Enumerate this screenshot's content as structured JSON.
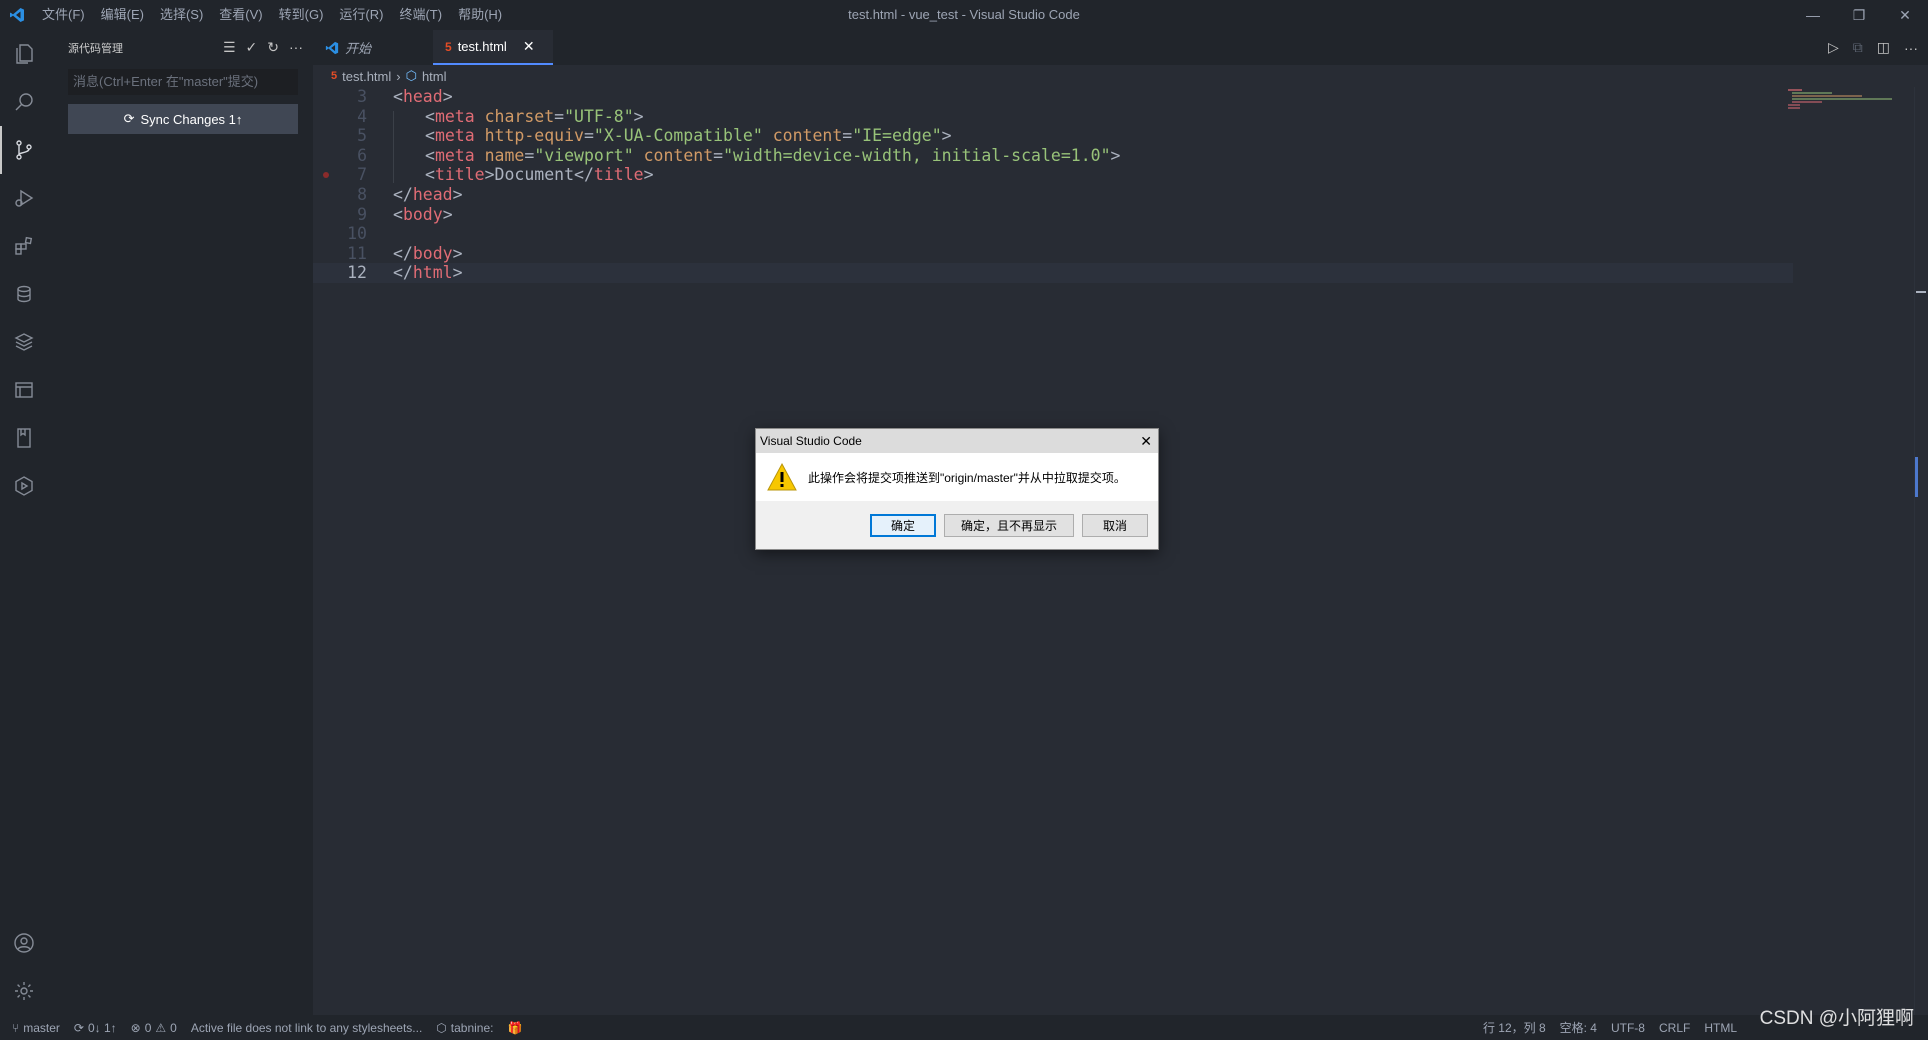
{
  "titlebar": {
    "menu": [
      "文件(F)",
      "编辑(E)",
      "选择(S)",
      "查看(V)",
      "转到(G)",
      "运行(R)",
      "终端(T)",
      "帮助(H)"
    ],
    "window_title": "test.html - vue_test - Visual Studio Code"
  },
  "sidebar": {
    "title": "源代码管理",
    "commit_placeholder": "消息(Ctrl+Enter 在\"master\"提交)",
    "sync_label": "Sync Changes 1↑"
  },
  "tabs": [
    {
      "label": "开始"
    },
    {
      "label": "test.html"
    }
  ],
  "breadcrumb": {
    "file": "test.html",
    "symbol": "html"
  },
  "editor": {
    "lines": [
      {
        "num": "3",
        "indent": 0,
        "tokens": [
          [
            "p",
            "<"
          ],
          [
            "t",
            "head"
          ],
          [
            "p",
            ">"
          ]
        ]
      },
      {
        "num": "4",
        "indent": 1,
        "tokens": [
          [
            "p",
            "<"
          ],
          [
            "t",
            "meta"
          ],
          [
            "p",
            " "
          ],
          [
            "a",
            "charset"
          ],
          [
            "p",
            "="
          ],
          [
            "s",
            "\"UTF-8\""
          ],
          [
            "p",
            ">"
          ]
        ]
      },
      {
        "num": "5",
        "indent": 1,
        "tokens": [
          [
            "p",
            "<"
          ],
          [
            "t",
            "meta"
          ],
          [
            "p",
            " "
          ],
          [
            "a",
            "http-equiv"
          ],
          [
            "p",
            "="
          ],
          [
            "s",
            "\"X-UA-Compatible\""
          ],
          [
            "p",
            " "
          ],
          [
            "a",
            "content"
          ],
          [
            "p",
            "="
          ],
          [
            "s",
            "\"IE=edge\""
          ],
          [
            "p",
            ">"
          ]
        ]
      },
      {
        "num": "6",
        "indent": 1,
        "tokens": [
          [
            "p",
            "<"
          ],
          [
            "t",
            "meta"
          ],
          [
            "p",
            " "
          ],
          [
            "a",
            "name"
          ],
          [
            "p",
            "="
          ],
          [
            "s",
            "\"viewport\""
          ],
          [
            "p",
            " "
          ],
          [
            "a",
            "content"
          ],
          [
            "p",
            "="
          ],
          [
            "s",
            "\"width=device-width, initial-scale=1.0\""
          ],
          [
            "p",
            ">"
          ]
        ]
      },
      {
        "num": "7",
        "indent": 1,
        "tokens": [
          [
            "p",
            "<"
          ],
          [
            "t",
            "title"
          ],
          [
            "p",
            ">Document</"
          ],
          [
            "t",
            "title"
          ],
          [
            "p",
            ">"
          ]
        ]
      },
      {
        "num": "8",
        "indent": 0,
        "tokens": [
          [
            "p",
            "</"
          ],
          [
            "t",
            "head"
          ],
          [
            "p",
            ">"
          ]
        ]
      },
      {
        "num": "9",
        "indent": 0,
        "tokens": [
          [
            "p",
            "<"
          ],
          [
            "t",
            "body"
          ],
          [
            "p",
            ">"
          ]
        ]
      },
      {
        "num": "10",
        "indent": 0,
        "tokens": []
      },
      {
        "num": "11",
        "indent": 0,
        "tokens": [
          [
            "p",
            "</"
          ],
          [
            "t",
            "body"
          ],
          [
            "p",
            ">"
          ]
        ]
      },
      {
        "num": "12",
        "indent": 0,
        "tokens": [
          [
            "p",
            "</"
          ],
          [
            "t",
            "html"
          ],
          [
            "p",
            ">"
          ]
        ]
      }
    ],
    "current_line": "12"
  },
  "dialog": {
    "title": "Visual Studio Code",
    "message": "此操作会将提交项推送到\"origin/master\"并从中拉取提交项。",
    "ok": "确定",
    "ok_dont_show": "确定，且不再显示",
    "cancel": "取消"
  },
  "statusbar": {
    "branch": "master",
    "sync": "0↓ 1↑",
    "errors": "0",
    "warnings": "0",
    "message": "Active file does not link to any stylesheets...",
    "tabnine": "tabnine:",
    "position": "行 12，列 8",
    "spaces": "空格: 4",
    "encoding": "UTF-8",
    "eol": "CRLF",
    "language": "HTML"
  },
  "watermark": "CSDN @小阿狸啊",
  "colors": {
    "accent": "#528bff",
    "tag": "#e06c75",
    "attr": "#d19a66",
    "string": "#98c379"
  }
}
